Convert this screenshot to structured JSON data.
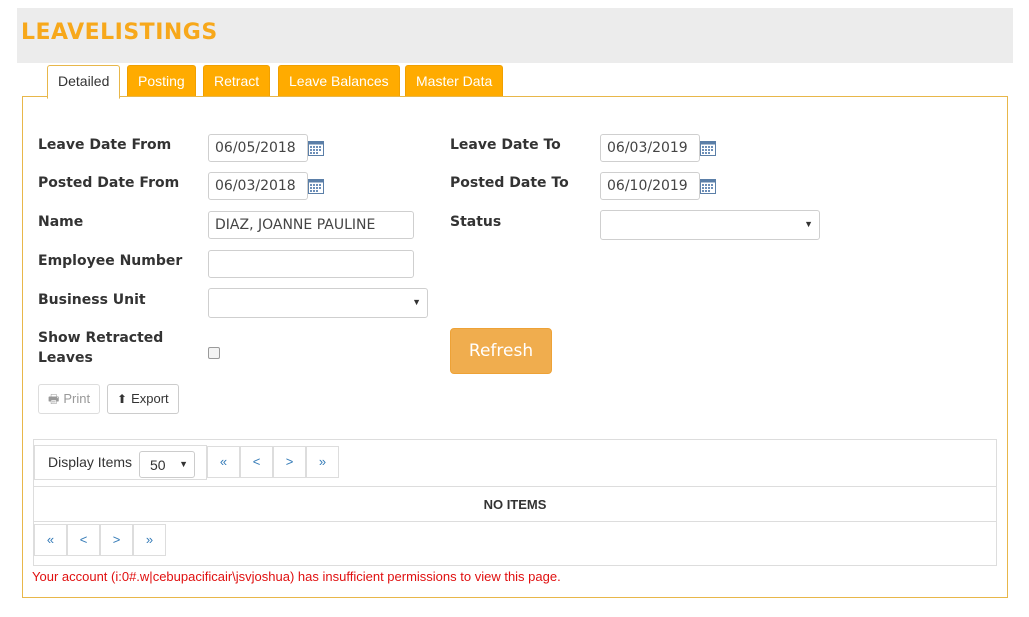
{
  "header": {
    "title": "LEAVELISTINGS"
  },
  "tabs": [
    {
      "label": "Detailed"
    },
    {
      "label": "Posting"
    },
    {
      "label": "Retract"
    },
    {
      "label": "Leave Balances"
    },
    {
      "label": "Master Data"
    }
  ],
  "form": {
    "leave_date_from": {
      "label": "Leave Date From",
      "value": "06/05/2018"
    },
    "leave_date_to": {
      "label": "Leave Date To",
      "value": "06/03/2019"
    },
    "posted_date_from": {
      "label": "Posted Date From",
      "value": "06/03/2018"
    },
    "posted_date_to": {
      "label": "Posted Date To",
      "value": "06/10/2019"
    },
    "name": {
      "label": "Name",
      "value": "DIAZ, JOANNE PAULINE"
    },
    "status": {
      "label": "Status",
      "value": ""
    },
    "employee_number": {
      "label": "Employee Number",
      "value": ""
    },
    "business_unit": {
      "label": "Business Unit",
      "value": ""
    },
    "show_retracted": {
      "label_line1": "Show Retracted",
      "label_line2": "Leaves",
      "checked": false
    },
    "refresh_label": "Refresh"
  },
  "toolbar": {
    "print_label": "Print",
    "export_label": "Export"
  },
  "grid": {
    "display_items_label": "Display Items",
    "display_items_value": "50",
    "pager": [
      "«",
      "<",
      ">",
      "»"
    ],
    "empty_text": "NO ITEMS"
  },
  "messages": {
    "permission_error": "Your account (i:0#.w|cebupacificair\\jsvjoshua) has insufficient permissions to view this page."
  },
  "colors": {
    "accent": "#ffab00",
    "refresh": "#f0ad4e",
    "error": "#e01010",
    "link": "#337ab7"
  }
}
